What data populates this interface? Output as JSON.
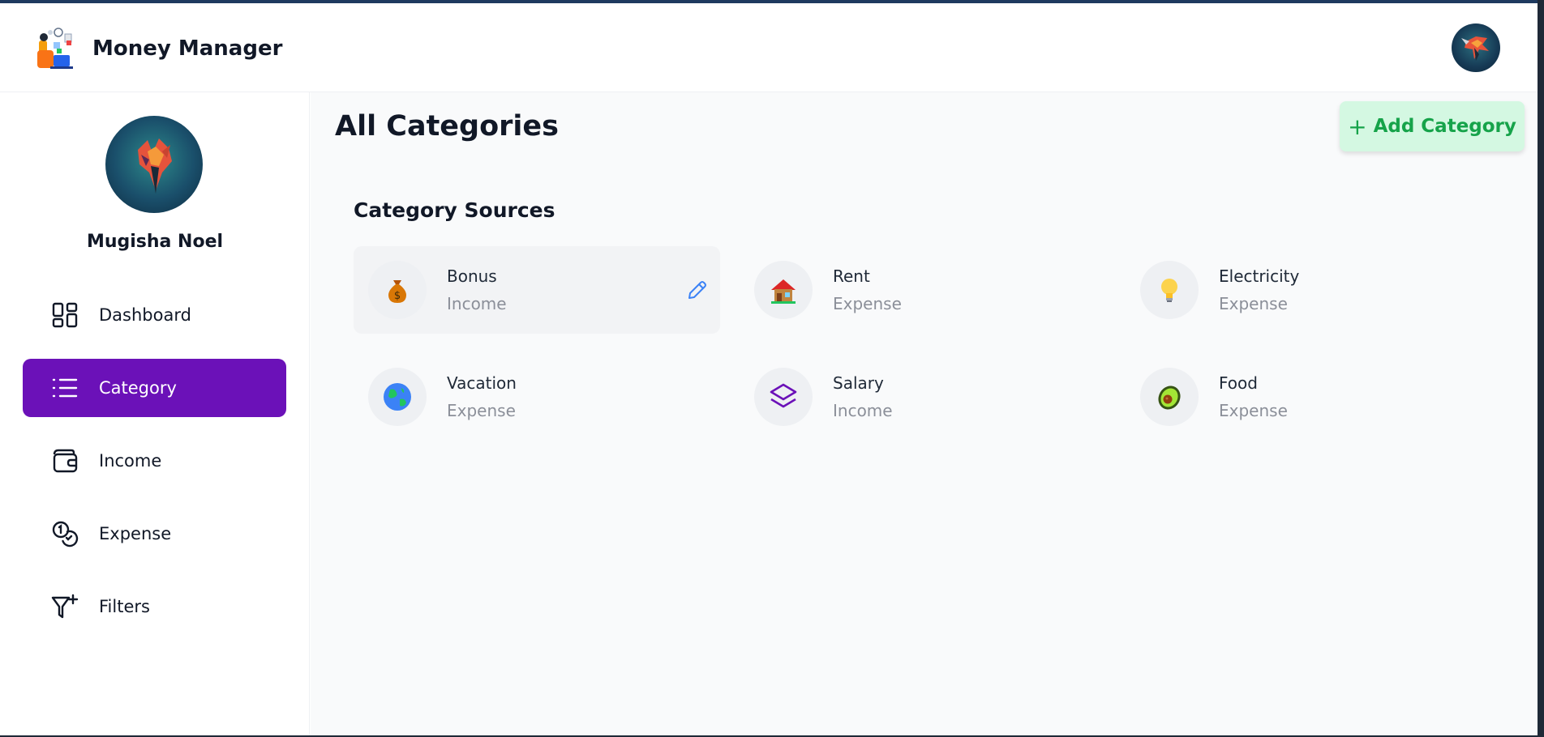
{
  "app": {
    "name": "Money Manager"
  },
  "profile": {
    "name": "Mugisha Noel"
  },
  "sidebar": {
    "items": [
      {
        "label": "Dashboard",
        "icon": "dashboard-grid-icon",
        "active": false
      },
      {
        "label": "Category",
        "icon": "list-icon",
        "active": true
      },
      {
        "label": "Income",
        "icon": "wallet-icon",
        "active": false
      },
      {
        "label": "Expense",
        "icon": "coins-icon",
        "active": false
      },
      {
        "label": "Filters",
        "icon": "funnel-plus-icon",
        "active": false
      }
    ]
  },
  "main": {
    "title": "All Categories",
    "add_button_label": "Add Category",
    "section_title": "Category Sources",
    "categories": [
      {
        "name": "Bonus",
        "type": "Income",
        "icon": "money-bag-icon"
      },
      {
        "name": "Rent",
        "type": "Expense",
        "icon": "house-icon"
      },
      {
        "name": "Electricity",
        "type": "Expense",
        "icon": "light-bulb-icon"
      },
      {
        "name": "Vacation",
        "type": "Expense",
        "icon": "globe-icon"
      },
      {
        "name": "Salary",
        "type": "Income",
        "icon": "layers-icon"
      },
      {
        "name": "Food",
        "type": "Expense",
        "icon": "avocado-icon"
      }
    ]
  },
  "colors": {
    "accent": "#6b11b8",
    "add_button_bg": "#d4f8e2",
    "add_button_text": "#16a34a",
    "muted_text": "#8b8f99",
    "edit_icon": "#3b82f6"
  }
}
